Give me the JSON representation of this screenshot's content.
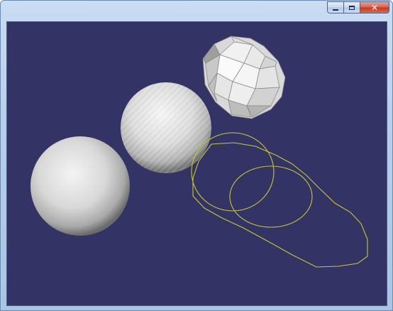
{
  "window": {
    "title": "",
    "buttons": {
      "minimize": "minimize",
      "maximize": "maximize",
      "close": "close"
    }
  },
  "viewport": {
    "background": "#333366",
    "wire_color": "#c8c832",
    "objects": [
      "smooth-sphere",
      "tessellated-sphere",
      "icosahedron",
      "wireframe-circles"
    ]
  },
  "icons": {
    "minimize": "minimize-icon",
    "maximize": "maximize-icon",
    "close": "close-icon"
  }
}
